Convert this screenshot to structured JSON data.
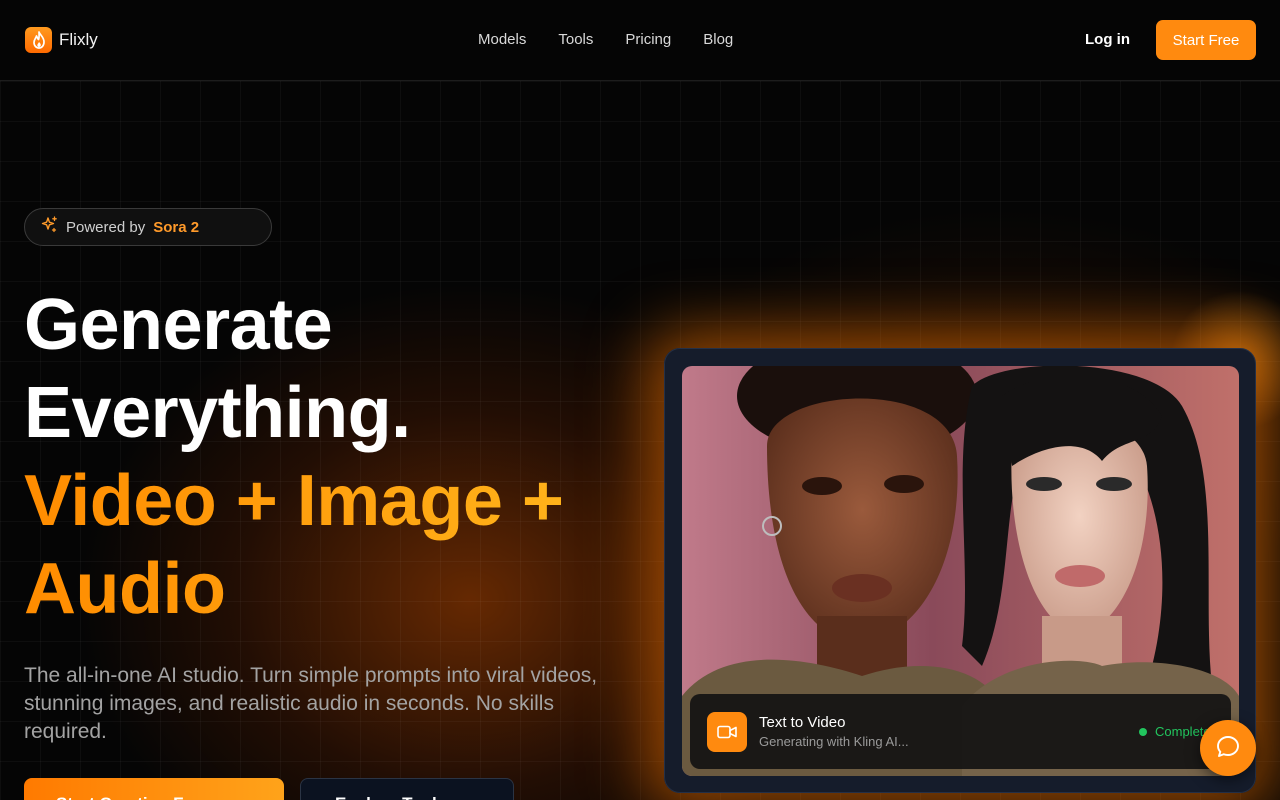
{
  "header": {
    "brand": "Flixly",
    "nav": [
      "Models",
      "Tools",
      "Pricing",
      "Blog"
    ],
    "login_label": "Log in",
    "start_free_label": "Start Free"
  },
  "hero": {
    "badge_prefix": "Powered by",
    "badge_accent": "Sora 2",
    "headline_line1": "Generate",
    "headline_line2": "Everything.",
    "headline_line3": "Video + Image +",
    "headline_line4": "Audio",
    "subtitle": "The all-in-one AI studio. Turn simple prompts into viral videos, stunning images, and realistic audio in seconds. No skills required.",
    "cta_primary": "Start Creating Free",
    "cta_secondary": "Explore Tools"
  },
  "showcase": {
    "task_title": "Text to Video",
    "task_subtitle": "Generating with Kling AI...",
    "status_label": "Completed"
  },
  "colors": {
    "accent": "#ff8a0f",
    "background": "#050505",
    "status_green": "#22c55e"
  },
  "icons": {
    "logo": "flame-icon",
    "badge": "sparkles-icon",
    "task": "video-camera-icon",
    "chat": "chat-bubble-icon"
  }
}
